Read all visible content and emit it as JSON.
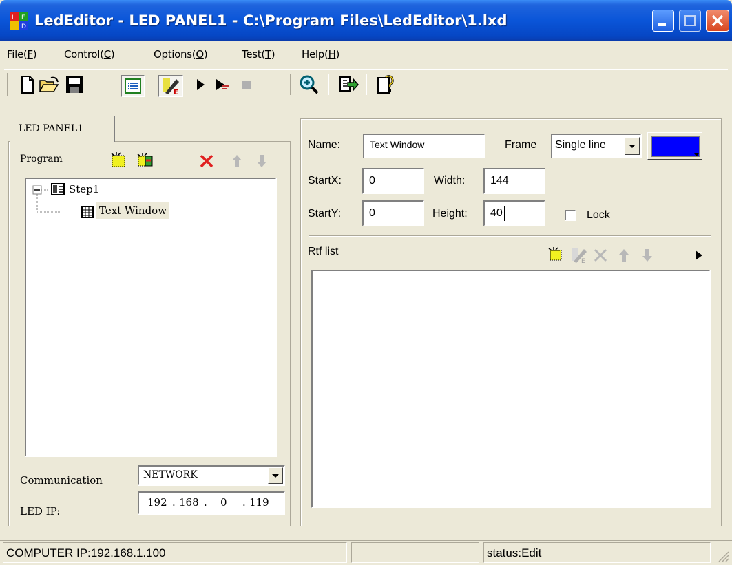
{
  "window": {
    "title": "LedEditor - LED PANEL1 - C:\\Program Files\\LedEditor\\1.lxd"
  },
  "menu": [
    "File(F)",
    "Control(C)",
    "Options(O)",
    "Test(T)",
    "Help(H)"
  ],
  "menu_underline": [
    "F",
    "C",
    "O",
    "T",
    "H"
  ],
  "toolbar": [
    "new-file-icon",
    "open-folder-icon",
    "save-icon",
    "grid-view-icon",
    "edit-text-icon",
    "play-icon",
    "play-step-icon",
    "stop-icon",
    "zoom-icon",
    "send-icon",
    "help-icon"
  ],
  "left": {
    "tab": "LED PANEL1",
    "program_label": "Program",
    "tree": {
      "step": "Step1",
      "child": "Text Window"
    },
    "communication_label": "Communication",
    "communication_value": "NETWORK",
    "ip_label": "LED IP:",
    "ip": [
      "192",
      "168",
      "0",
      "119"
    ]
  },
  "props": {
    "name_label": "Name:",
    "name_value": "Text Window",
    "frame_label": "Frame",
    "frame_value": "Single line",
    "frame_color": "#0000ff",
    "startx_label": "StartX:",
    "startx_value": "0",
    "width_label": "Width:",
    "width_value": "144",
    "starty_label": "StartY:",
    "starty_value": "0",
    "height_label": "Height:",
    "height_value": "40",
    "lock_label": "Lock",
    "rtf_label": "Rtf list"
  },
  "status": {
    "computer_ip": "COMPUTER IP:192.168.1.100",
    "middle": "",
    "state": "status:Edit"
  }
}
